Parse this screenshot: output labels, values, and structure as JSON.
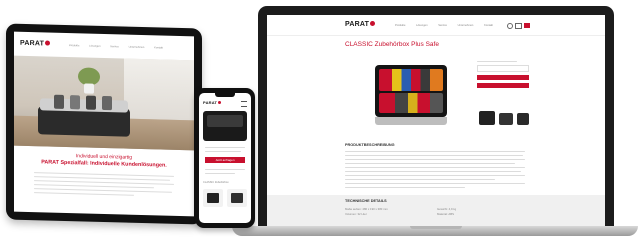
{
  "brand": {
    "logo_text": "PARAT",
    "accent_color": "#c8102e"
  },
  "tablet": {
    "nav_items": [
      "Produkte",
      "Lösungen",
      "Service",
      "Unternehmen",
      "Kontakt"
    ],
    "headline_line1": "Individuell und einzigartig",
    "headline_line2": "PARAT Spezialfall: Individuelle Kundenlösungen."
  },
  "phone": {
    "button_label": "Jetzt anfragen",
    "caption": "CLASSIC Zubehörbox"
  },
  "laptop": {
    "nav_items": [
      "Produkte",
      "Lösungen",
      "Service",
      "Unternehmen",
      "Kontakt"
    ],
    "product_title": "CLASSIC Zubehörbox Plus Safe",
    "section_description": "PRODUKTBESCHREIBUNG",
    "section_details": "TECHNISCHE DETAILS",
    "details_left": [
      "Maße außen: 480 x 190 x 380 mm",
      "Volumen: 32 Liter"
    ],
    "details_right": [
      "Gewicht: 4,9 kg",
      "Material: ABS"
    ]
  }
}
